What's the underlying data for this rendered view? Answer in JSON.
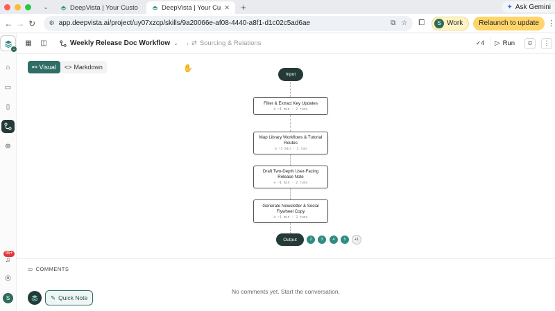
{
  "browser": {
    "tabs": [
      {
        "title": "DeepVista | Your Customer Pl",
        "active": false
      },
      {
        "title": "DeepVista | Your Customer Pl",
        "active": true
      }
    ],
    "ask_gemini": "Ask Gemini",
    "url": "app.deepvista.ai/project/uy07xzcp/skills/9a20066e-af08-4440-a8f1-d1c02c5ad6ae",
    "profile_label": "Work",
    "profile_initial": "S",
    "relaunch_label": "Relaunch to update"
  },
  "rail": {
    "notification_badge": "99+",
    "avatar_initial": "S"
  },
  "header": {
    "workflow_title": "Weekly Release Doc Workflow",
    "breadcrumb_next": "Sourcing & Relations",
    "count": "4",
    "run_label": "Run"
  },
  "view_toggle": {
    "visual_label": "Visual",
    "markdown_label": "Markdown"
  },
  "flow": {
    "input_label": "Input",
    "output_label": "Output",
    "steps": [
      {
        "title": "Filter & Extract Key Updates",
        "meta": "⊙ ~1 min · 2 runs"
      },
      {
        "title": "Map Library Workflows & Tutorial Routes",
        "meta": "⊙ ~1 min · 1 run"
      },
      {
        "title": "Draft Two-Depth User-Facing Release Note",
        "meta": "⊙ ~1 min · 2 runs"
      },
      {
        "title": "Generate Newsletter & Social Flywheel Copy",
        "meta": "⊙ ~1 min · 2 runs"
      }
    ],
    "versions": [
      "2",
      "3",
      "4",
      "5",
      "+1"
    ]
  },
  "comments": {
    "heading": "COMMENTS",
    "empty_text": "No comments yet. Start the conversation.",
    "quick_note_label": "Quick Note"
  },
  "colors": {
    "accent": "#2f6e66",
    "dark_node": "#243a37",
    "version_chip": "#2f8c82",
    "badge": "#e0393e",
    "relaunch": "#ffd56a"
  }
}
